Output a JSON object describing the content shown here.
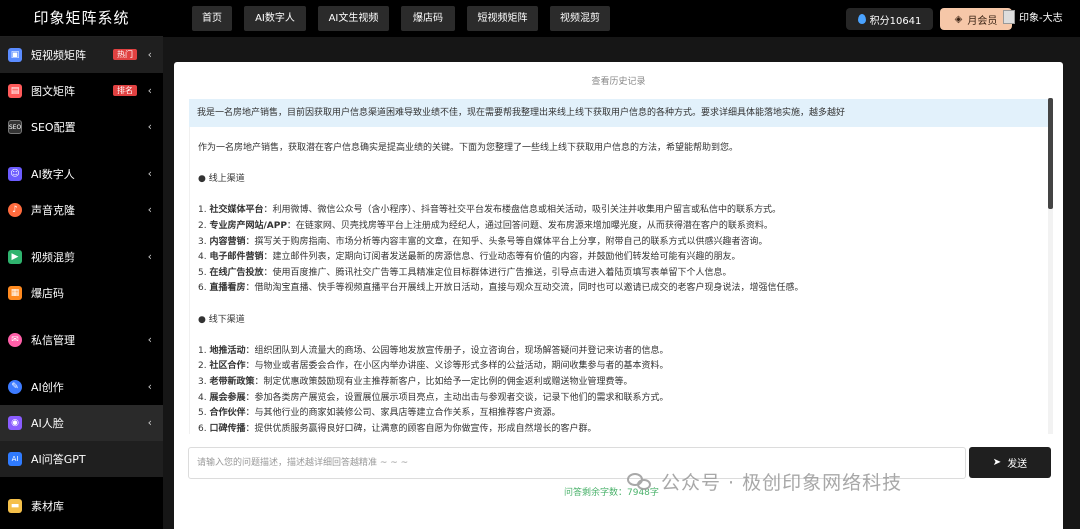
{
  "app": {
    "title": "印象矩阵系统"
  },
  "sidebar": {
    "items": [
      {
        "label": "短视频矩阵",
        "badge": "热门",
        "icon": "video-matrix-icon",
        "color": "#5b8cff"
      },
      {
        "label": "图文矩阵",
        "badge": "排名",
        "icon": "image-text-icon",
        "color": "#ff5a5a"
      },
      {
        "label": "SEO配置",
        "badge": "",
        "icon": "seo-icon",
        "color": "#333333"
      },
      {
        "label": "AI数字人",
        "badge": "",
        "icon": "digital-human-icon",
        "color": "#6c5cff"
      },
      {
        "label": "声音克隆",
        "badge": "",
        "icon": "voice-clone-icon",
        "color": "#ff6b3d"
      },
      {
        "label": "视频混剪",
        "badge": "",
        "icon": "video-edit-icon",
        "color": "#2fb36e"
      },
      {
        "label": "爆店码",
        "badge": "",
        "icon": "qrcode-icon",
        "color": "#ff8a1f"
      },
      {
        "label": "私信管理",
        "badge": "",
        "icon": "message-icon",
        "color": "#ff5fa8"
      },
      {
        "label": "AI创作",
        "badge": "",
        "icon": "ai-create-icon",
        "color": "#3d7bff"
      },
      {
        "label": "AI人脸",
        "badge": "",
        "icon": "ai-face-icon",
        "color": "#8a5cff"
      },
      {
        "label": "AI问答GPT",
        "badge": "",
        "icon": "ai-gpt-icon",
        "color": "#2f7bff"
      },
      {
        "label": "素材库",
        "badge": "",
        "icon": "folder-icon",
        "color": "#f5c04a"
      }
    ]
  },
  "topbar": {
    "tabs": [
      "首页",
      "AI数字人",
      "AI文生视频",
      "爆店码",
      "短视频矩阵",
      "视频混剪"
    ],
    "points": "积分10641",
    "vip": "月会员",
    "user": "印象-大志"
  },
  "main": {
    "history_label": "查看历史记录",
    "question": "我是一名房地产销售，目前因获取用户信息渠道困难导致业绩不佳，现在需要帮我整理出来线上线下获取用户信息的各种方式。要求详细具体能落地实施，越多越好",
    "answer": {
      "intro": "作为一名房地产销售，获取潜在客户信息确实是提高业绩的关键。下面为您整理了一些线上线下获取用户信息的方法，希望能帮助到您。",
      "online_title": "● 线上渠道",
      "online": [
        {
          "n": "1.",
          "k": "社交媒体平台",
          "t": "：利用微博、微信公众号（含小程序）、抖音等社交平台发布楼盘信息或相关活动，吸引关注并收集用户留言或私信中的联系方式。"
        },
        {
          "n": "2.",
          "k": "专业房产网站/APP",
          "t": "：在链家网、贝壳找房等平台上注册成为经纪人，通过回答问题、发布房源来增加曝光度，从而获得潜在客户的联系资料。"
        },
        {
          "n": "3.",
          "k": "内容营销",
          "t": "：撰写关于购房指南、市场分析等内容丰富的文章，在知乎、头条号等自媒体平台上分享，附带自己的联系方式以供感兴趣者咨询。"
        },
        {
          "n": "4.",
          "k": "电子邮件营销",
          "t": "：建立邮件列表，定期向订阅者发送最新的房源信息、行业动态等有价值的内容，并鼓励他们转发给可能有兴趣的朋友。"
        },
        {
          "n": "5.",
          "k": "在线广告投放",
          "t": "：使用百度推广、腾讯社交广告等工具精准定位目标群体进行广告推送，引导点击进入着陆页填写表单留下个人信息。"
        },
        {
          "n": "6.",
          "k": "直播看房",
          "t": "：借助淘宝直播、快手等视频直播平台开展线上开放日活动，直接与观众互动交流，同时也可以邀请已成交的老客户现身说法，增强信任感。"
        }
      ],
      "offline_title": "● 线下渠道",
      "offline": [
        {
          "n": "1.",
          "k": "地推活动",
          "t": "：组织团队到人流量大的商场、公园等地发放宣传册子，设立咨询台，现场解答疑问并登记来访者的信息。"
        },
        {
          "n": "2.",
          "k": "社区合作",
          "t": "：与物业或者居委会合作，在小区内举办讲座、义诊等形式多样的公益活动，期间收集参与者的基本资料。"
        },
        {
          "n": "3.",
          "k": "老带新政策",
          "t": "：制定优惠政策鼓励现有业主推荐新客户，比如给予一定比例的佣金返利或赠送物业管理费等。"
        },
        {
          "n": "4.",
          "k": "展会参展",
          "t": "：参加各类房产展览会，设置展位展示项目亮点，主动出击与参观者交谈，记录下他们的需求和联系方式。"
        },
        {
          "n": "5.",
          "k": "合作伙伴",
          "t": "：与其他行业的商家如装修公司、家具店等建立合作关系，互相推荐客户资源。"
        },
        {
          "n": "6.",
          "k": "口碑传播",
          "t": "：提供优质服务赢得良好口碑，让满意的顾客自愿为你做宣传，形成自然增长的客户群。"
        }
      ]
    },
    "input_placeholder": "请输入您的问题描述，描述越详细回答越精准 ~ ~ ~",
    "input_value": "",
    "send_label": "发送",
    "remain_text": "问答剩余字数：7948字"
  },
  "watermark": {
    "text": "公众号 · 极创印象网络科技"
  },
  "colors": {
    "accent": "#1f1f1f",
    "question_bg": "#e2f1fb",
    "vip_bg": "#f6c7a8",
    "badge_red": "#e04141",
    "remain_green": "#4db36d"
  }
}
